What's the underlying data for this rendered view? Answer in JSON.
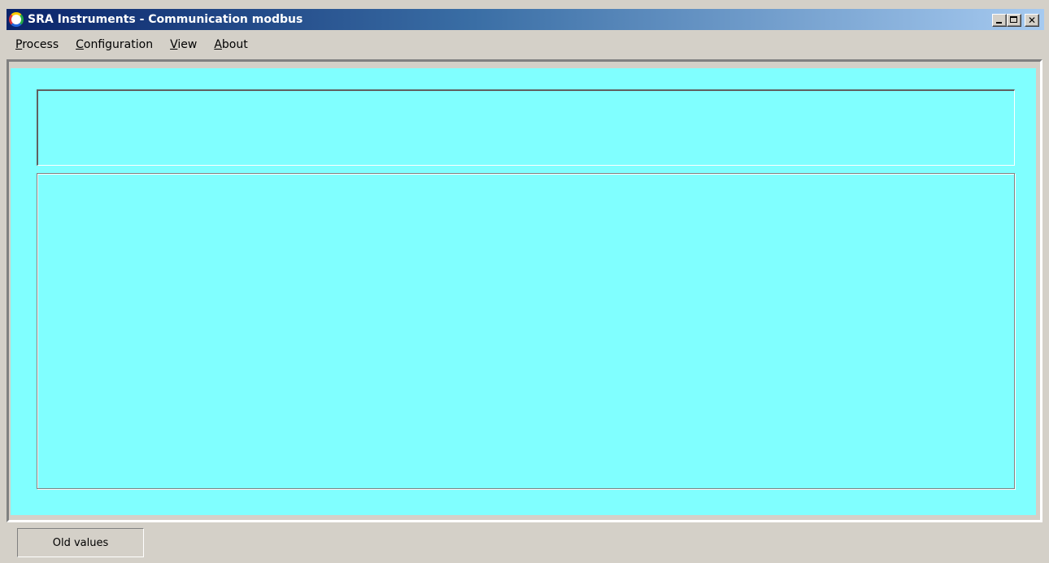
{
  "window": {
    "title": "SRA Instruments - Communication modbus",
    "icon": "app-logo-icon",
    "controls": {
      "minimize_icon": "minimize-icon",
      "maximize_icon": "maximize-icon",
      "close_icon": "close-icon",
      "close_glyph": "✕"
    }
  },
  "menu": {
    "items": [
      {
        "key": "P",
        "rest": "rocess"
      },
      {
        "key": "C",
        "rest": "onfiguration"
      },
      {
        "key": "V",
        "rest": "iew"
      },
      {
        "key": "A",
        "rest": "bout"
      }
    ]
  },
  "panels": {
    "background_color": "#80ffff"
  },
  "status": {
    "old_values_label": "Old values"
  }
}
